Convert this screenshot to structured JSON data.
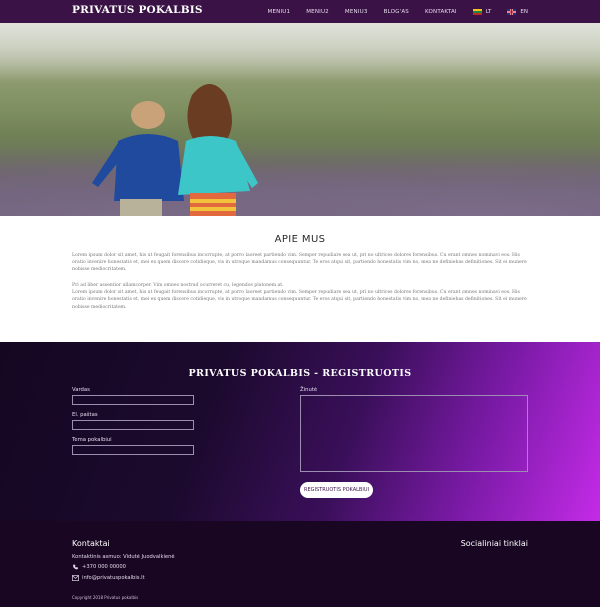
{
  "header": {
    "brand": "PRIVATUS POKALBIS",
    "nav": [
      "MENIU1",
      "MENIU2",
      "MENIU3",
      "BLOG'AS",
      "KONTAKTAI"
    ],
    "languages": [
      {
        "code": "LT",
        "flag": "lithuania-flag-icon"
      },
      {
        "code": "EN",
        "flag": "uk-flag-icon"
      }
    ]
  },
  "about": {
    "title": "APIE MUS",
    "p1": "Lorem ipsum dolor sit amet, his ut feugait forensibus incorrupte, at porro laoreet partiendo vim. Semper repudiare sea ut, pri no ultrices dolores forensibus. Cu erant omnes nominavi eos. His oratio invenire honestatis et, mei ex quem discere cotidieque, vis in utroque mandamus consequuntur. Te eros atqui sit, partiendo honestatis vim no, mea ne definiebas definitiones. Sit ei munere nobisse mediocritatem.",
    "p2": "Pri ad liber assentior ullamcorper. Vim omnes nostrud ocurreret cu, legendos platonem at.\nLorem ipsum dolor sit amet, his ut feugait forensibus incorrupte, at porro laoreet partiendo vim. Semper repudiare sea ut, pri no ultrices dolores forensibus. Cu erant omnes nominavi eos. His oratio invenire honestatis et, mei ex quem discere cotidieque, vis in utroque mandamus consequuntur. Te eros atqui sit, partiendo honestatis vim no, mea ne definiebas definitiones. Sit ei munere nobisse mediocritatem."
  },
  "registration": {
    "title": "PRIVATUS POKALBIS - REGISTRUOTIS",
    "labels": {
      "name": "Vardas",
      "email": "El. paštas",
      "topic": "Tema pokalbiui",
      "message": "Žinutė"
    },
    "submit": "REGISTRUOTIS POKALBIUI"
  },
  "footer": {
    "contacts_title": "Kontaktai",
    "contact_person": "Kontaktinis asmuo: Vidutė Juodvalkienė",
    "phone": "+370 000 00000",
    "email": "info@privatuspokalbis.lt",
    "social_title": "Socialiniai tinklai",
    "copyright": "Copyright  2018 Privatus pokalbis"
  },
  "colors": {
    "header_bg": "#3a1245",
    "footer_bg": "#190623",
    "accent": "#c42be8"
  }
}
